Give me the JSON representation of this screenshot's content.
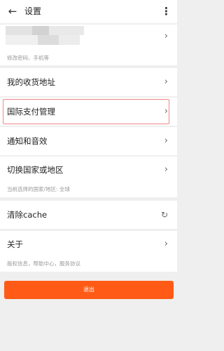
{
  "header": {
    "title": "设置"
  },
  "profile": {
    "hint": "修改密码、手机等"
  },
  "menu": {
    "address": "我的收货地址",
    "payment": "国际支付管理",
    "notify": "通知和音效",
    "country": "切换国家或地区",
    "country_hint": "当前选择的国家/地区: 全球",
    "cache": "清除cache",
    "about": "关于",
    "about_hint": "版权信息，帮助中心，服务协议"
  },
  "logout": {
    "label": "退出"
  },
  "icons": {
    "back": "arrow-left-icon",
    "more": "more-vertical-icon",
    "chevron": "chevron-right-icon",
    "refresh": "refresh-icon"
  },
  "colors": {
    "accent": "#ff5a16",
    "highlight_border": "#f0868b",
    "background": "#efefef"
  }
}
